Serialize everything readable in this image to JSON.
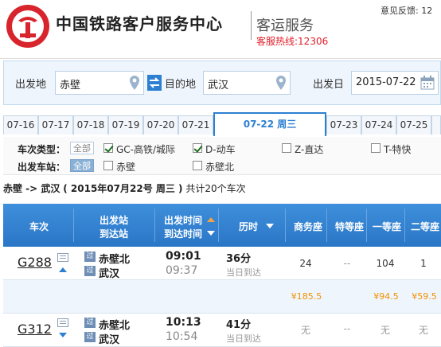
{
  "header": {
    "title": "中国铁路客户服务中心",
    "subtitle": "客运服务",
    "hotline": "客服热线:12306",
    "feedback": "意见反馈: 12"
  },
  "search": {
    "from_label": "出发地",
    "from_value": "赤壁",
    "to_label": "目的地",
    "to_value": "武汉",
    "date_label": "出发日",
    "date_value": "2015-07-22"
  },
  "date_tabs": [
    "07-16",
    "07-17",
    "07-18",
    "07-19",
    "07-20",
    "07-21",
    "07-22 周三",
    "07-23",
    "07-24",
    "07-25"
  ],
  "active_date_tab": 6,
  "filters": {
    "type_label": "车次类型：",
    "station_label": "出发车站：",
    "all_label": "全部",
    "types": [
      {
        "label": "GC-高铁/城际",
        "checked": true
      },
      {
        "label": "D-动车",
        "checked": true
      },
      {
        "label": "Z-直达",
        "checked": false
      },
      {
        "label": "T-特快",
        "checked": false
      }
    ],
    "stations": [
      {
        "label": "赤壁",
        "checked": false
      },
      {
        "label": "赤壁北",
        "checked": false
      }
    ]
  },
  "summary": {
    "route": "赤壁 -> 武汉",
    "date_info": "( 2015年07月22号  周三 )",
    "count": "共计20个车次"
  },
  "table": {
    "col_train": "车次",
    "col_station_1": "出发站",
    "col_station_2": "到达站",
    "col_time_1": "出发时间",
    "col_time_2": "到达时间",
    "col_duration": "历时",
    "col_business": "商务座",
    "col_premium": "特等座",
    "col_first": "一等座",
    "col_second": "二等座",
    "rows": [
      {
        "train": "G288",
        "badge_from": "过",
        "badge_to": "过",
        "from": "赤壁北",
        "to": "武汉",
        "depart": "09:01",
        "arrive": "09:37",
        "duration": "36分",
        "arrival_note": "当日到达",
        "business": "24",
        "premium": "--",
        "first": "104",
        "second": "1",
        "price_business": "¥185.5",
        "price_first": "¥94.5",
        "price_second": "¥59.5"
      },
      {
        "train": "G312",
        "badge_from": "过",
        "badge_to": "过",
        "from": "赤壁北",
        "to": "武汉",
        "depart": "10:13",
        "arrive": "10:54",
        "duration": "41分",
        "arrival_note": "当日到达",
        "business": "无",
        "premium": "--",
        "first": "无",
        "second": "无"
      }
    ]
  },
  "colors": {
    "brand_red": "#e0202a",
    "accent_blue": "#2c7fd1",
    "price_orange": "#f29200"
  }
}
